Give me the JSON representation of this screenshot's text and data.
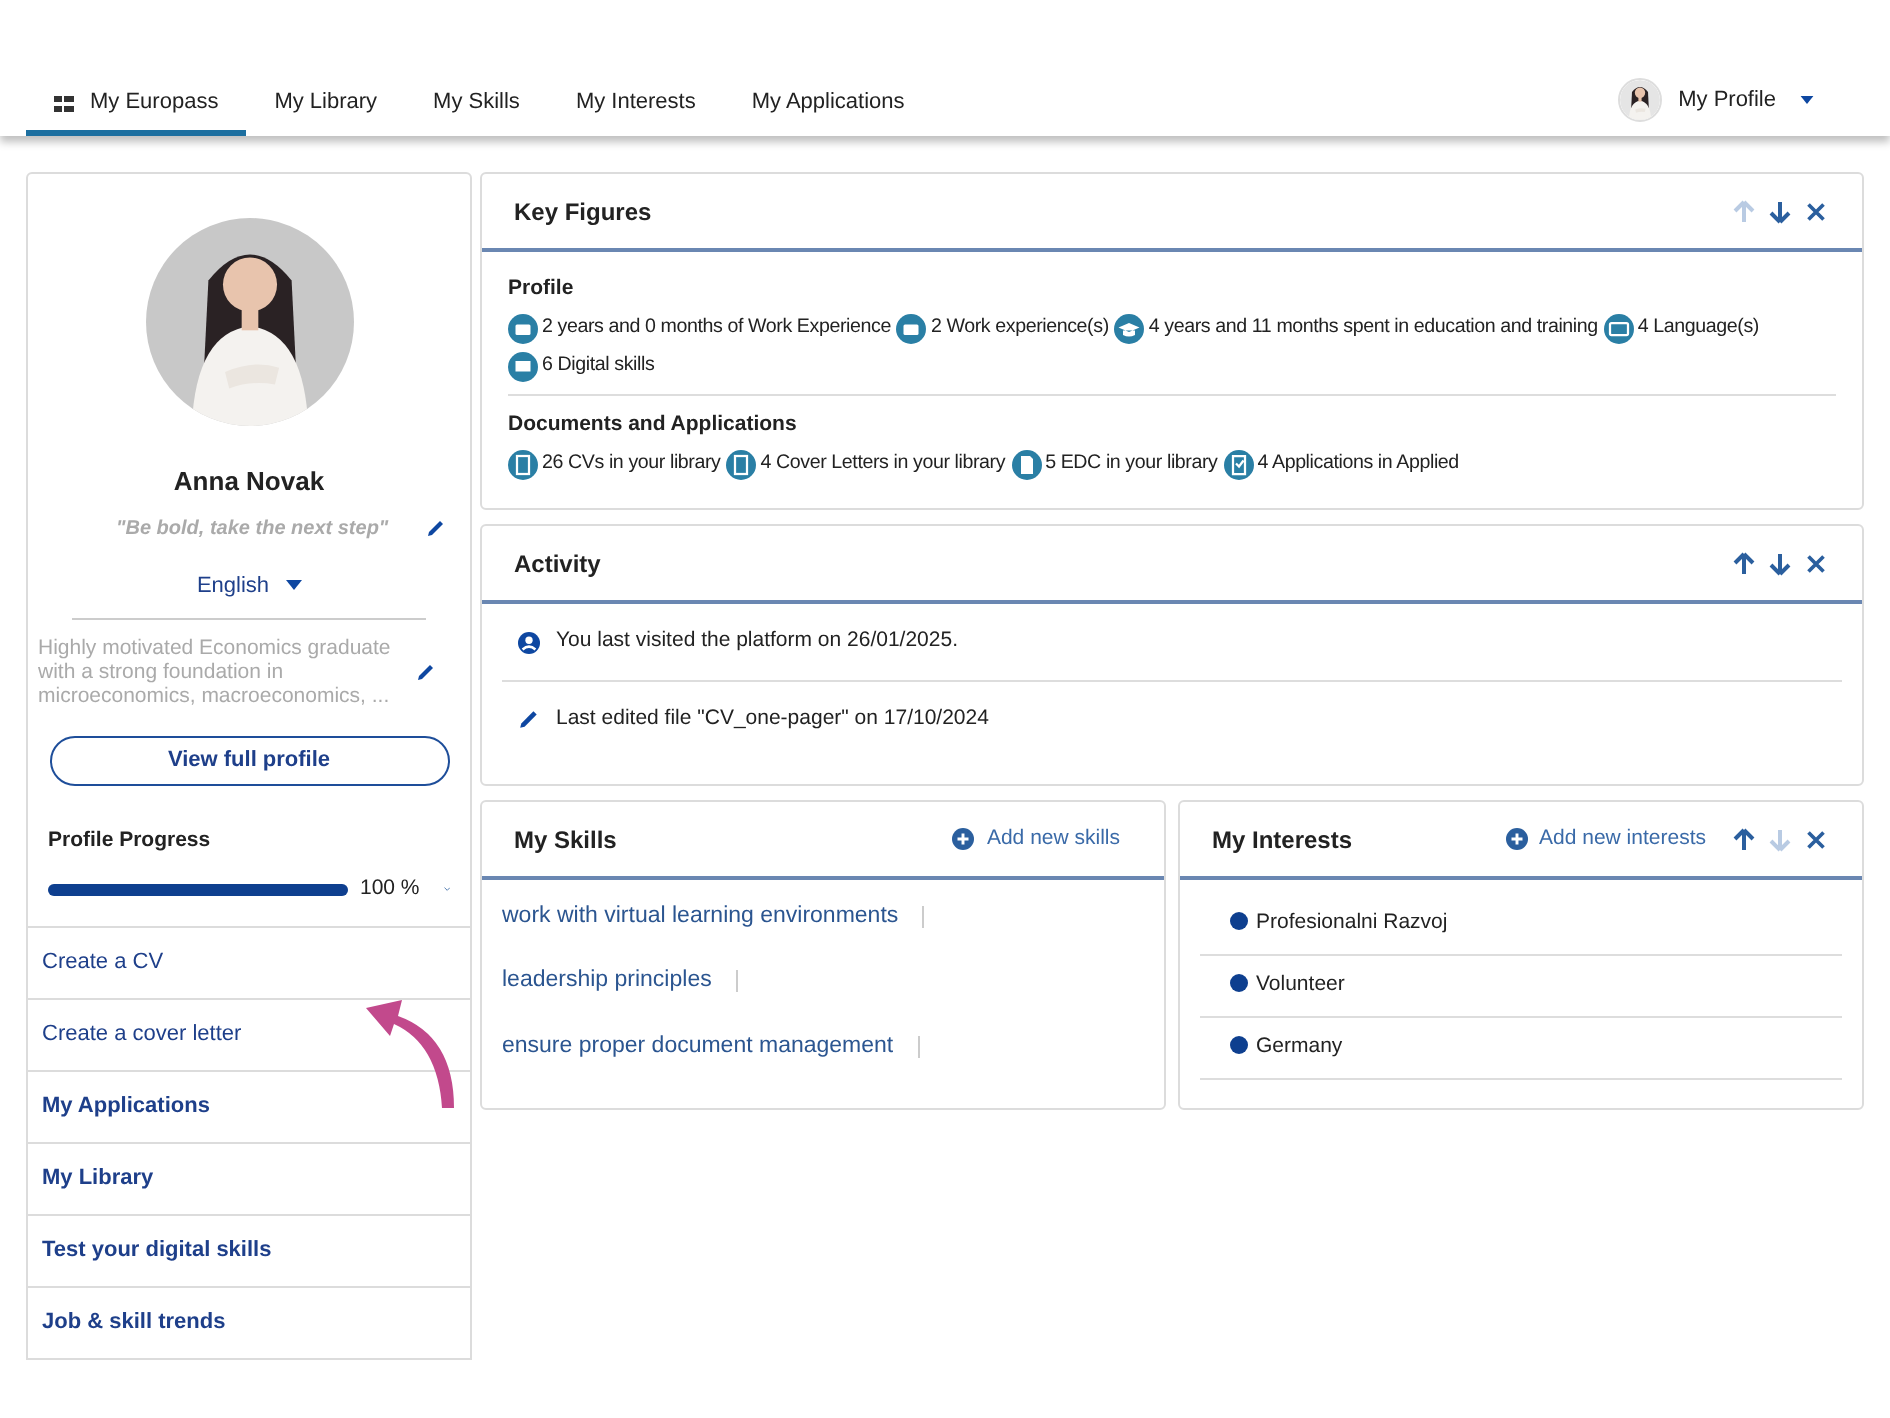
{
  "nav": {
    "tabs": [
      {
        "label": "My Europass",
        "selected": true,
        "icon": true
      },
      {
        "label": "My Library",
        "selected": false,
        "icon": false
      },
      {
        "label": "My Skills",
        "selected": false,
        "icon": false
      },
      {
        "label": "My Interests",
        "selected": false,
        "icon": false
      },
      {
        "label": "My Applications",
        "selected": false,
        "icon": false
      }
    ],
    "profile_menu": "My Profile"
  },
  "profile": {
    "name": "Anna Novak",
    "motto": "\"Be bold, take the next step\"",
    "language": "English",
    "bio": "Highly motivated Economics graduate with a strong foundation in microeconomics, macroeconomics, ...",
    "view_button": "View full profile",
    "progress_label": "Profile Progress",
    "level": 1,
    "progress_text": "100 %"
  },
  "side_menu": [
    {
      "label": "Create a CV",
      "kind": "action"
    },
    {
      "label": "Create a cover letter",
      "kind": "action"
    },
    {
      "label": "My Applications",
      "kind": "section"
    },
    {
      "label": "My Library",
      "kind": "section"
    },
    {
      "label": "Test your digital skills",
      "kind": "section"
    },
    {
      "label": "Job & skill trends",
      "kind": "section"
    }
  ],
  "key_figures": {
    "title": "Key Figures",
    "controls": [
      {
        "kind": "up",
        "disabled": true
      },
      {
        "kind": "down",
        "disabled": false
      },
      {
        "kind": "close",
        "disabled": false
      }
    ],
    "groups": [
      {
        "heading": "Profile",
        "items": [
          {
            "kind": "work",
            "text": "2 years and 0 months of Work Experience"
          },
          {
            "kind": "work",
            "text": "2 Work experience(s)"
          },
          {
            "kind": "education",
            "text": "4 years and 11 months spent in education and training"
          },
          {
            "kind": "language",
            "text": "4 Language(s)"
          },
          {
            "kind": "digital",
            "text": "6 Digital skills"
          }
        ]
      },
      {
        "heading": "Documents and Applications",
        "items": [
          {
            "kind": "cv",
            "text": "26 CVs in your library"
          },
          {
            "kind": "letter",
            "text": "4 Cover Letters in your library"
          },
          {
            "kind": "document",
            "text": "5 EDC in your library"
          },
          {
            "kind": "application",
            "text": "4 Applications in Applied"
          }
        ]
      }
    ]
  },
  "activity": {
    "title": "Activity",
    "controls": [
      {
        "kind": "up",
        "disabled": false
      },
      {
        "kind": "down",
        "disabled": false
      },
      {
        "kind": "close",
        "disabled": false
      }
    ],
    "items": [
      {
        "kind": "visit",
        "text": "You last visited the platform on 26/01/2025."
      },
      {
        "kind": "edit",
        "text": "Last edited file \"CV_one-pager\" on 17/10/2024"
      }
    ]
  },
  "skills": {
    "title": "My Skills",
    "add": "Add new skills",
    "items": [
      "work with virtual learning environments",
      "leadership principles",
      "ensure proper document management"
    ]
  },
  "interests": {
    "title": "My Interests",
    "add": "Add new interests",
    "controls": [
      {
        "kind": "up",
        "disabled": false
      },
      {
        "kind": "down",
        "disabled": true
      },
      {
        "kind": "close",
        "disabled": false
      }
    ],
    "items": [
      "Profesionalni Razvoj",
      "Volunteer",
      "Germany"
    ]
  }
}
